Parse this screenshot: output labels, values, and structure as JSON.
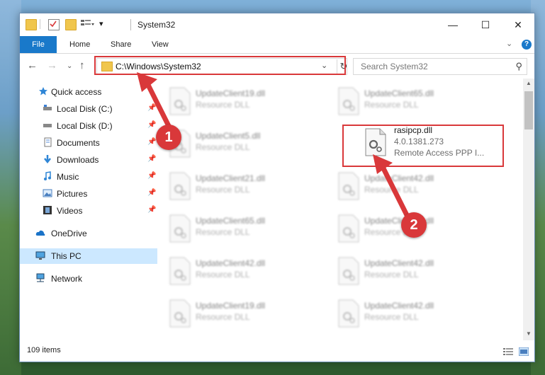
{
  "window": {
    "title": "System32",
    "controls": {
      "minimize": "—",
      "maximize": "☐",
      "close": "✕"
    }
  },
  "ribbon": {
    "tabs": [
      "File",
      "Home",
      "Share",
      "View"
    ],
    "expand_icon": "chevron-down-icon",
    "help_label": "?"
  },
  "address": {
    "path": "C:\\Windows\\System32",
    "search_placeholder": "Search System32"
  },
  "nav_pane": {
    "items": [
      {
        "label": "Quick access",
        "icon": "star-icon",
        "pinned": false
      },
      {
        "label": "Local Disk (C:)",
        "icon": "drive-icon",
        "pinned": true
      },
      {
        "label": "Local Disk (D:)",
        "icon": "drive-icon",
        "pinned": true
      },
      {
        "label": "Documents",
        "icon": "documents-icon",
        "pinned": true
      },
      {
        "label": "Downloads",
        "icon": "download-icon",
        "pinned": true
      },
      {
        "label": "Music",
        "icon": "music-icon",
        "pinned": true
      },
      {
        "label": "Pictures",
        "icon": "pictures-icon",
        "pinned": true
      },
      {
        "label": "Videos",
        "icon": "videos-icon",
        "pinned": true
      },
      {
        "label": "OneDrive",
        "icon": "cloud-icon",
        "pinned": false
      },
      {
        "label": "This PC",
        "icon": "computer-icon",
        "pinned": false
      },
      {
        "label": "Network",
        "icon": "network-icon",
        "pinned": false
      }
    ]
  },
  "files": {
    "col1": [
      {
        "name": "UpdateClient19.dll",
        "type": "Resource DLL"
      },
      {
        "name": "UpdateClient5.dll",
        "type": "Resource DLL"
      },
      {
        "name": "UpdateClient21.dll",
        "type": "Resource DLL"
      },
      {
        "name": "UpdateClient65.dll",
        "type": "Resource DLL"
      },
      {
        "name": "UpdateClient42.dll",
        "type": "Resource DLL"
      },
      {
        "name": "UpdateClient19.dll",
        "type": "Resource DLL"
      }
    ],
    "col2": [
      {
        "name": "UpdateClient65.dll",
        "type": "Resource DLL"
      },
      {
        "name": "UpdateClient42.dll",
        "type": "Resource DLL"
      },
      {
        "name": "UpdateClient42.dll",
        "type": "Resource DLL"
      },
      {
        "name": "UpdateClient42.dll",
        "type": "Resource DLL"
      },
      {
        "name": "UpdateClient42.dll",
        "type": "Resource DLL"
      }
    ],
    "highlighted": {
      "name": "rasipcp.dll",
      "version": "4.0.1381.273",
      "description": "Remote Access PPP I..."
    }
  },
  "status": {
    "item_count": "109 items"
  },
  "annotations": {
    "badge1": "1",
    "badge2": "2",
    "color": "#d9383a"
  }
}
